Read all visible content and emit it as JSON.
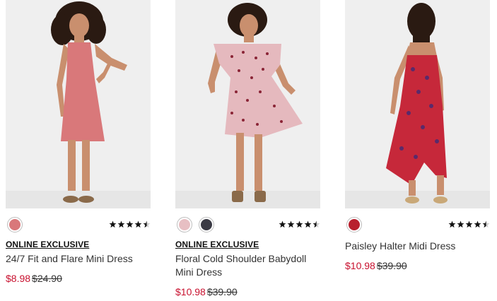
{
  "products": [
    {
      "image_alt": "",
      "swatch_colors": [
        "#d9787a"
      ],
      "rating": 4.5,
      "badge": "ONLINE EXCLUSIVE",
      "name": "24/7 Fit and Flare Mini Dress",
      "sale_price": "$8.98",
      "original_price": "$24.90"
    },
    {
      "image_alt": "",
      "swatch_colors": [
        "#e7bfc3",
        "#3a3a44"
      ],
      "rating": 4.5,
      "badge": "ONLINE EXCLUSIVE",
      "name": "Floral Cold Shoulder Babydoll Mini Dress",
      "sale_price": "$10.98",
      "original_price": "$39.90"
    },
    {
      "image_alt": "",
      "swatch_colors": [
        "#b8202e"
      ],
      "rating": 4.5,
      "badge": "",
      "name": "Paisley Halter Midi Dress",
      "sale_price": "$10.98",
      "original_price": "$39.90"
    }
  ],
  "colors": {
    "sale": "#c8102e",
    "star": "#111111"
  }
}
